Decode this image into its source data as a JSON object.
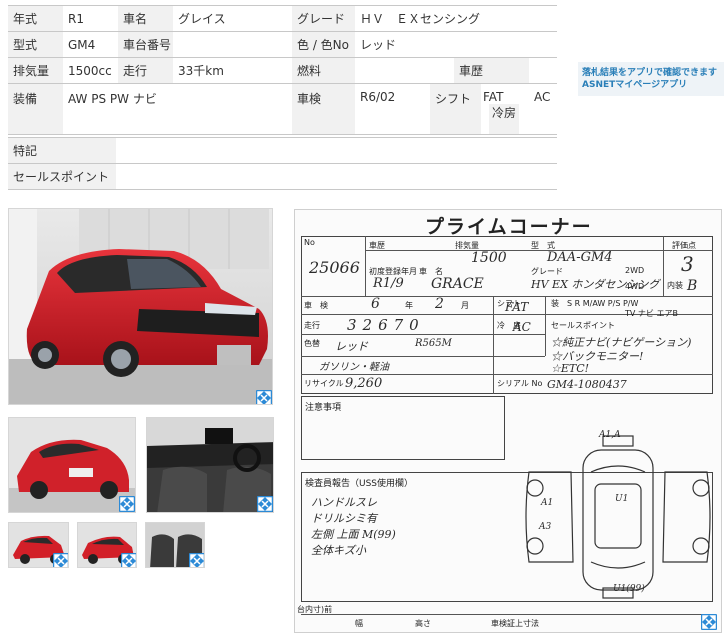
{
  "spec": {
    "row1": {
      "k1": "年式",
      "v1": "R1",
      "k2": "車名",
      "v2": "グレイス",
      "k3": "グレード",
      "v3": "ＨＶ　ＥＸセンシング"
    },
    "row2": {
      "k1": "型式",
      "v1": "GM4",
      "k2": "車台番号",
      "v2": "",
      "k3": "色 / 色No",
      "v3": "レッド"
    },
    "row3": {
      "k1": "排気量",
      "v1": "1500cc",
      "k2": "走行",
      "v2": "33千km",
      "k3": "燃料",
      "v3": "",
      "k4": "車歴",
      "v4": ""
    },
    "row4": {
      "k1": "装備",
      "v1": "AW PS PW ナビ",
      "k3": "車検",
      "v3": "R6/02",
      "k4": "シフト",
      "v4": "FAT",
      "k5": "冷房",
      "v5": "AC"
    },
    "extra": {
      "k1": "特記",
      "v1": "",
      "k2": "セールスポイント",
      "v2": ""
    }
  },
  "banner": {
    "line1": "落札結果をアプリで確認できます",
    "line2": "ASNETマイページアプリ"
  },
  "sheet": {
    "title": "プライムコーナー",
    "labels": {
      "no": "No",
      "car": "車歴",
      "displacement": "排気量",
      "model": "型　式",
      "grade_box": "評価点",
      "first_reg": "初度登録年月",
      "car_name": "車　名",
      "grade": "グレード",
      "shaken": "車　検",
      "shift": "シフト",
      "mileage": "走行",
      "aircon": "冷　房",
      "sales_point": "セールスポイント",
      "color": "色替",
      "notes": "注意事項",
      "inspector": "検査員報告（USS使用欄）",
      "recycle": "リサイクル",
      "serial": "シリアル No",
      "equip": "装　S R M/AW P/S P/W",
      "equip2": "TV ナビ エアB",
      "wd2": "2WD",
      "wd4": "4WD",
      "interior": "内装",
      "year": "年",
      "month": "月",
      "bottom_left": "台内寸)前",
      "bottom_right": "車検証上寸法",
      "width": "幅",
      "height": "高さ"
    },
    "hand": {
      "no": "25066",
      "disp": "1500",
      "model": "DAA-GM4",
      "grade_score": "3",
      "interior_score": "B",
      "first_reg": "R1/9",
      "name": "GRACE",
      "grade": "HV EX ホンダセンシング",
      "shaken_y": "6",
      "shaken_m": "2",
      "shift": "FAT",
      "mileage": "32670",
      "ac": "AC",
      "color": "レッド",
      "color_no": "R565M",
      "fuel": "ガソリン・軽油",
      "recycle": "9,260",
      "reg_no": "GM4-1080437",
      "sp1": "☆純正ナビ(ナビゲーション)",
      "sp2": "☆バックモニター!",
      "sp3": "☆ETC!",
      "ins1": "ハンドルスレ",
      "ins2": "ドリルシミ有",
      "ins3": "左側 上面 M(99)",
      "ins4": "全体キズ小",
      "map_top": "A1,A",
      "map_a1": "A1",
      "map_a3": "A3",
      "map_u1": "U1",
      "map_u1b": "U1(99)"
    }
  }
}
